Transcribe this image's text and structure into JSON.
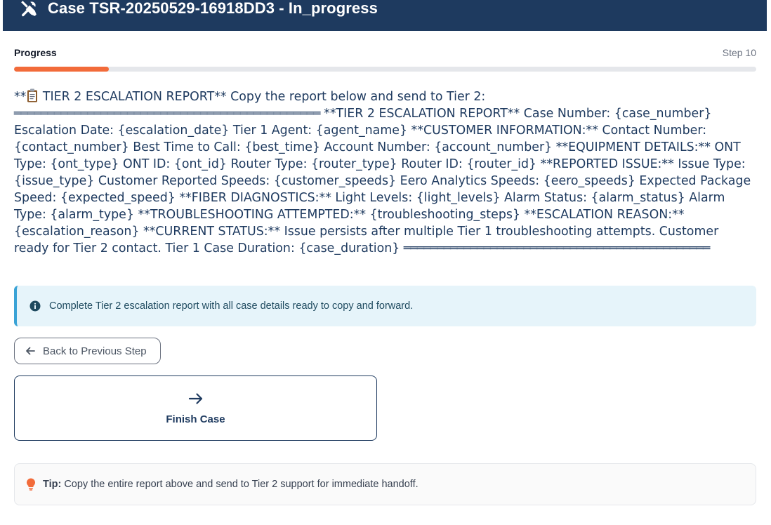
{
  "header": {
    "title": "Case TSR-20250529-16918DD3 - In_progress",
    "icon": "tools-icon",
    "background": "#1e3a5f"
  },
  "progress": {
    "label": "Progress",
    "step_text": "Step 10",
    "fraction": 0.128,
    "color": "#f26b3a"
  },
  "report": {
    "prefix": "**",
    "icon": "clipboard-icon",
    "text_a": " TIER 2 ESCALATION REPORT** Copy the report below and send to Tier 2: ",
    "rule": "══════════════════════════════════════════════",
    "text_b": " **TIER 2 ESCALATION REPORT** Case Number: {case_number} Escalation Date: {escalation_date} Tier 1 Agent: {agent_name} **CUSTOMER INFORMATION:** Contact Number: {contact_number} Best Time to Call: {best_time} Account Number: {account_number} **EQUIPMENT DETAILS:** ONT Type: {ont_type} ONT ID: {ont_id} Router Type: {router_type} Router ID: {router_id} **REPORTED ISSUE:** Issue Type: {issue_type} Customer Reported Speeds: {customer_speeds} Eero Analytics Speeds: {eero_speeds} Expected Package Speed: {expected_speed} **FIBER DIAGNOSTICS:** Light Levels: {light_levels} Alarm Status: {alarm_status} Alarm Type: {alarm_type} **TROUBLESHOOTING ATTEMPTED:** {troubleshooting_steps} **ESCALATION REASON:** {escalation_reason} **CURRENT STATUS:** Issue persists after multiple Tier 1 troubleshooting attempts. Customer ready for Tier 2 contact. Tier 1 Case Duration: {case_duration} ",
    "rule_end": "══════════════════════════════════════════════"
  },
  "info": {
    "icon": "info-icon",
    "text": "Complete Tier 2 escalation report with all case details ready to copy and forward."
  },
  "buttons": {
    "back_label": "Back to Previous Step",
    "finish_label": "Finish Case"
  },
  "tip": {
    "icon": "lightbulb-icon",
    "strong": "Tip:",
    "text": "Copy the entire report above and send to Tier 2 support for immediate handoff."
  }
}
